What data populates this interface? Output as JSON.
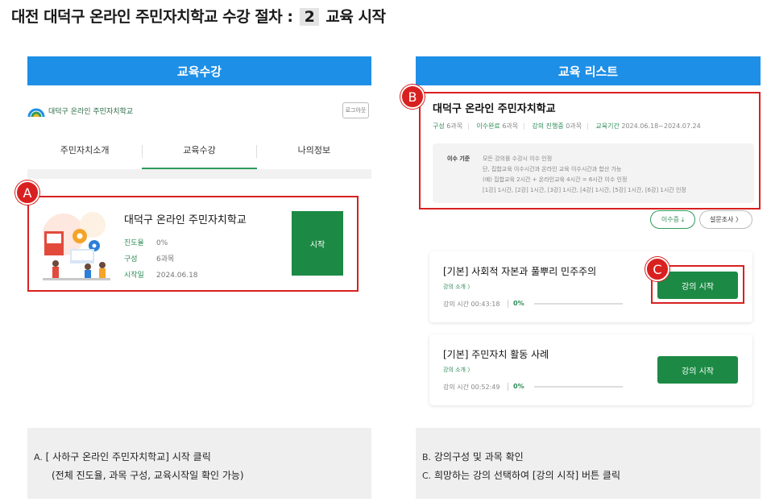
{
  "header": {
    "title_prefix": "대전 대덕구 온라인 주민자치학교 수강 절차 :",
    "step_number": "2",
    "title_suffix": "교육 시작"
  },
  "colors": {
    "blue": "#1e8fe6",
    "green": "#1c8a45",
    "red": "#d92020"
  },
  "left_panel": {
    "bar_title": "교육수강",
    "logo_text": "대덕구 온라인 주민자치학교",
    "logout_label": "로그아웃",
    "tabs": [
      {
        "label": "주민자치소개"
      },
      {
        "label": "교육수강"
      },
      {
        "label": "나의정보"
      }
    ],
    "active_tab": "교육수강",
    "badge": "A",
    "course": {
      "name": "대덕구 온라인 주민자치학교",
      "progress_label": "진도율",
      "progress_value": "0%",
      "composition_label": "구성",
      "composition_value": "6과목",
      "start_date_label": "시작일",
      "start_date_value": "2024.06.18",
      "start_button": "시작"
    }
  },
  "right_panel": {
    "bar_title": "교육 리스트",
    "badge_b": "B",
    "badge_c": "C",
    "list_title": "대덕구 온라인 주민자치학교",
    "meta": {
      "composition_label": "구성",
      "composition_value": "6과목",
      "completed_label": "이수완료",
      "completed_value": "6과목",
      "in_progress_label": "강의 진행중",
      "in_progress_value": "0과목",
      "period_label": "교육기간",
      "period_value": "2024.06.18~2024.07.24"
    },
    "criteria": {
      "label": "이수 기준",
      "lines": [
        "모든 강의를 수강시 이수 인정",
        "단, 집합교육 이수시간과 온라인 교육 이수시간과 합산 가능",
        "(예) 집합교육 2시간 + 온라인교육 4시간 = 6시간 이수 인정",
        "[1강] 1시간, [2강] 1시간, [3강] 1시간, [4강] 1시간, [5강] 1시간, [6강] 1시간 인정"
      ]
    },
    "certificate_button": "이수증 ⤓",
    "survey_button": "설문조사 〉",
    "lectures": [
      {
        "title": "[기본] 사회적 자본과 풀뿌리 민주주의",
        "link": "강의 소개 〉",
        "time": "강의 시간 00:43:18",
        "percent": "0%",
        "progress": 0,
        "button": "강의 시작"
      },
      {
        "title": "[기본] 주민자치 활동 사례",
        "link": "강의 소개 〉",
        "time": "강의 시간 00:52:49",
        "percent": "0%",
        "progress": 0,
        "button": "강의 시작"
      }
    ]
  },
  "notes": {
    "left": {
      "a_label": "A.",
      "a_text": "[ 사하구 온라인 주민자치학교] 시작 클릭",
      "a_sub": "(전체 진도율, 과목 구성, 교육시작일 확인 가능)"
    },
    "right": {
      "b_label": "B.",
      "b_text": "강의구성 및 과목 확인",
      "c_label": "C.",
      "c_text": "희망하는 강의 선택하여 [강의 시작] 버튼 클릭"
    }
  }
}
